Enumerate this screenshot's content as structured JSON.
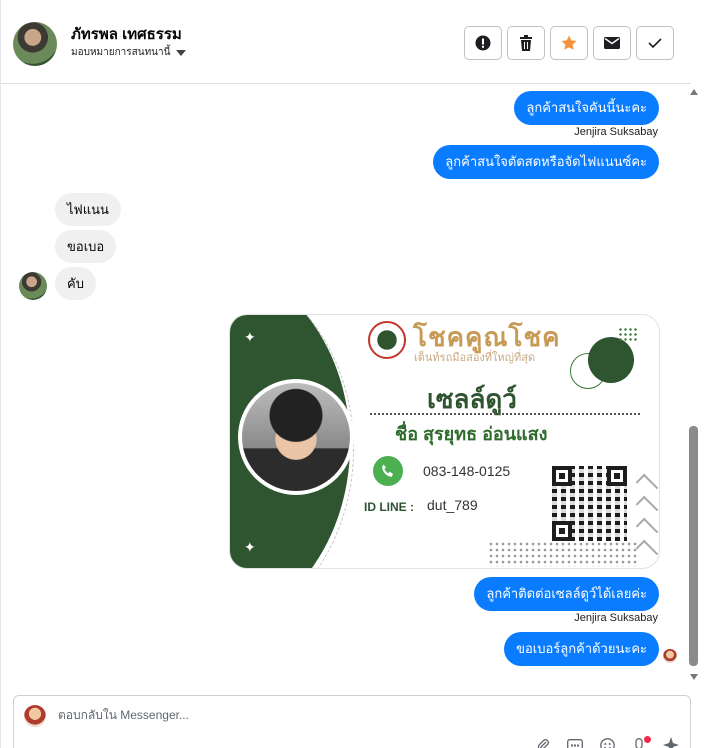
{
  "header": {
    "contact_name": "ภัทรพล เทศธรรม",
    "assign_label": "มอบหมายการสนทนานี้",
    "actions": [
      {
        "name": "spam-button",
        "icon": "exclamation-circle-icon"
      },
      {
        "name": "delete-button",
        "icon": "trash-icon"
      },
      {
        "name": "star-button",
        "icon": "star-icon"
      },
      {
        "name": "mark-unread-button",
        "icon": "envelope-icon"
      },
      {
        "name": "mark-done-button",
        "icon": "checkmark-icon"
      }
    ]
  },
  "messages": {
    "out_1": "ลูกค้าสนใจคันนี้นะคะ",
    "sender_1": "Jenjira Suksabay",
    "out_2": "ลูกค้าสนใจตัดสดหรือจัดไฟแนนซ์คะ",
    "in_1": "ไฟแนน",
    "in_2": "ขอเบอ",
    "in_3": "คับ",
    "out_3": "ลูกค้าติดต่อเซลล์ดูว์ได้เลยค่ะ",
    "sender_2": "Jenjira Suksabay",
    "out_4": "ขอเบอร์ลูกค้าด้วยนะคะ"
  },
  "card": {
    "brand": "โชคคูณโชค",
    "slogan": "เต็นท์รถมือสองที่ใหญ่ที่สุด",
    "title": "เซลล์ดูว์",
    "name": "ชื่อ สุรยุทธ อ่อนแสง",
    "phone": "083-148-0125",
    "id_line_label": "ID LINE :",
    "id_line_value": "dut_789",
    "colors": {
      "green": "#2f5530",
      "gold": "#c79a55"
    }
  },
  "composer": {
    "placeholder": "ตอบกลับใน Messenger...",
    "tools": [
      "attach-icon",
      "gif-icon",
      "emoji-icon",
      "sticker-icon",
      "sparkle-icon"
    ]
  },
  "colors": {
    "accent": "#0a7cff",
    "incoming": "#f0f0f0"
  }
}
